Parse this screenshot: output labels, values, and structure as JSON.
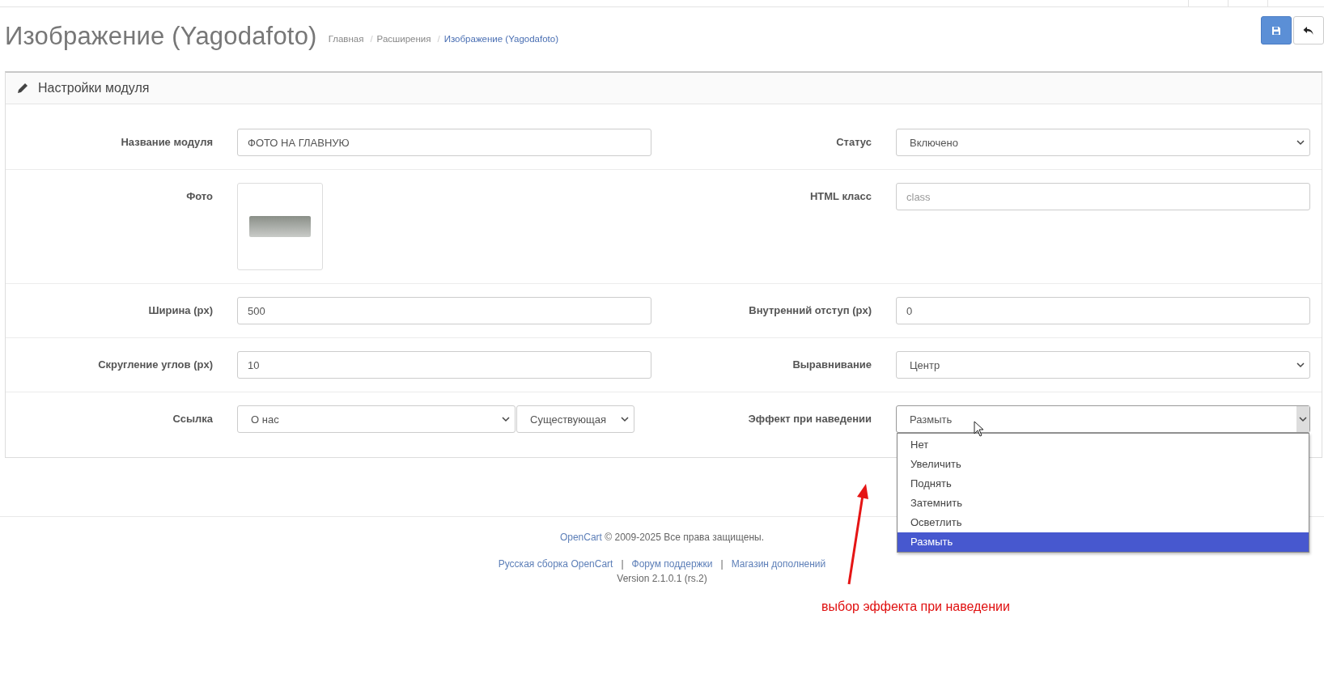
{
  "header": {
    "title": "Изображение (Yagodafoto)",
    "breadcrumbs": [
      {
        "label": "Главная",
        "current": false
      },
      {
        "label": "Расширения",
        "current": false
      },
      {
        "label": "Изображение (Yagodafoto)",
        "current": true
      }
    ],
    "separator": "/",
    "buttons": [
      {
        "kind": "save"
      },
      {
        "kind": "back"
      }
    ]
  },
  "panel": {
    "title": "Настройки модуля"
  },
  "rows": [
    {
      "left": {
        "kind": "text",
        "label": "Название модуля",
        "value": "ФОТО НА ГЛАВНУЮ"
      },
      "right": {
        "kind": "select",
        "label": "Статус",
        "value": "Включено",
        "expanded": false
      }
    },
    {
      "left": {
        "kind": "image",
        "label": "Фото"
      },
      "right": {
        "kind": "text",
        "label": "HTML класс",
        "placeholder": "class"
      }
    },
    {
      "left": {
        "kind": "text",
        "label": "Ширина (px)",
        "value": "500"
      },
      "right": {
        "kind": "text",
        "label": "Внутренний отступ (px)",
        "value": "0"
      }
    },
    {
      "left": {
        "kind": "text",
        "label": "Скругление углов (px)",
        "value": "10"
      },
      "right": {
        "kind": "select",
        "label": "Выравнивание",
        "value": "Центр",
        "expanded": false
      }
    },
    {
      "left": {
        "kind": "select_pair",
        "label": "Ссылка",
        "values": [
          "О нас",
          "Существующая"
        ]
      },
      "right": {
        "kind": "select",
        "label": "Эффект при наведении",
        "value": "Размыть",
        "expanded": true,
        "options": [
          {
            "label": "Нет",
            "selected": false
          },
          {
            "label": "Увеличить",
            "selected": false
          },
          {
            "label": "Поднять",
            "selected": false
          },
          {
            "label": "Затемнить",
            "selected": false
          },
          {
            "label": "Осветлить",
            "selected": false
          },
          {
            "label": "Размыть",
            "selected": true
          }
        ]
      }
    }
  ],
  "footer": {
    "brand_link": "OpenCart",
    "copyright": "© 2009-2025 Все права защищены.",
    "links": [
      "Русская сборка OpenCart",
      "Форум поддержки",
      "Магазин дополнений"
    ],
    "separator": "|",
    "version": "Version 2.1.0.1 (rs.2)"
  },
  "annotation": {
    "text": "выбор эффекта при наведении"
  }
}
